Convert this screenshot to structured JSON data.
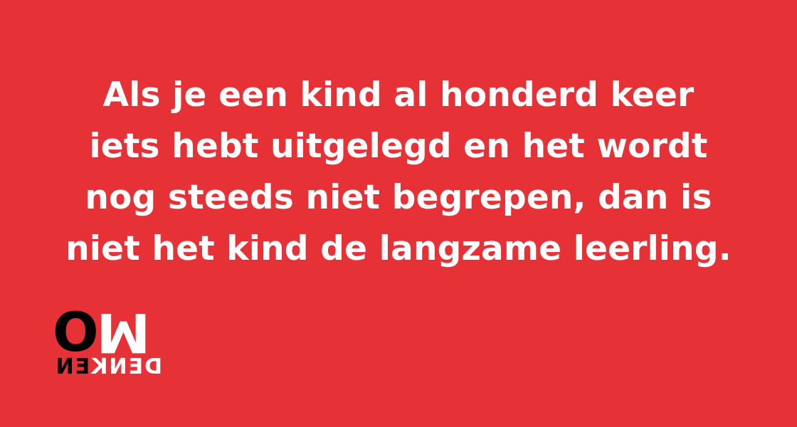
{
  "colors": {
    "background": "#e63236",
    "text": "#ffffff",
    "logo_dark": "#000000"
  },
  "quote": {
    "lines": [
      "Als je een kind al honderd keer",
      "iets hebt uitgelegd en het wordt",
      "nog steeds niet begrepen, dan is",
      "niet het kind de langzame leerling."
    ]
  },
  "logo": {
    "top_left": "O",
    "top_right": "M",
    "bottom_light": "DENK",
    "bottom_dark": "EN"
  }
}
